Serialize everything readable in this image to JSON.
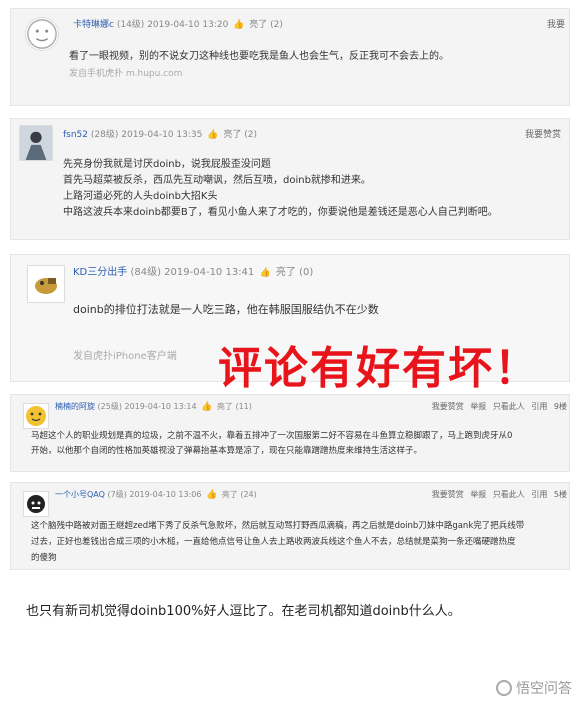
{
  "comments": [
    {
      "user": "卡特琳娜c",
      "level": "(14级)",
      "time": "2019-04-10 13:20",
      "like_label": "亮了",
      "like_count": "(2)",
      "right_action": "我要",
      "lines": [
        "看了一眼视频，别的不说女刀这种线也要吃我是鱼人也会生气，反正我可不会去上的。"
      ],
      "source": "发自手机虎扑 m.hupu.com"
    },
    {
      "user": "fsn52",
      "level": "(28级)",
      "time": "2019-04-10 13:35",
      "like_label": "亮了",
      "like_count": "(2)",
      "right_action": "我要赞赏",
      "lines": [
        "先亮身份我就是讨厌doinb，说我屁股歪没问题",
        "首先马超菜被反杀，西瓜先互动嘲讽，然后互喷，doinb就掺和进来。",
        "上路河道必死的人头doinb大招K头",
        "中路这波兵本来doinb都要B了，看见小鱼人来了才吃的，你要说他是差钱还是恶心人自己判断吧。"
      ]
    },
    {
      "user": "KD三分出手",
      "level": "(84级)",
      "time": "2019-04-10 13:41",
      "like_label": "亮了",
      "like_count": "(0)",
      "lines": [
        "doinb的排位打法就是一人吃三路，他在韩服国服结仇不在少数"
      ],
      "source": "发自虎扑iPhone客户端"
    },
    {
      "user": "楠楠的阿旋",
      "level": "(25级)",
      "time": "2019-04-10 13:14",
      "like_label": "亮了",
      "like_count": "(11)",
      "right_actions": [
        "我要赞赏",
        "举报",
        "只看此人",
        "引用",
        "9楼"
      ],
      "lines": [
        "马超这个人的职业规划是真的垃圾，之前不温不火，靠着五排冲了一次国服第二好不容易在斗鱼算立稳脚跟了，马上跑到虎牙从0",
        "开始，以他那个自闭的性格加英雄视没了弹幕抬基本算是凉了，现在只能靠蹭蹭热度来维持生活这样子。"
      ]
    },
    {
      "user": "一个小号QAQ",
      "level": "(7级)",
      "time": "2019-04-10 13:06",
      "like_label": "亮了",
      "like_count": "(24)",
      "right_actions": [
        "我要赞赏",
        "举报",
        "只看此人",
        "引用",
        "5楼"
      ],
      "lines": [
        "这个脑残中路被对面王继超zed堵下秀了反杀气急败坏，然后就互动骂打野西瓜滴稿，再之后就是doinb刀妹中路gank完了把兵线带",
        "过去，正好也差钱出合成三项的小木槌，一直给他点信号让鱼人去上路收两波兵线这个鱼人不去，总结就是菜狗一条还嘴硬蹭热度",
        "的傻狗"
      ]
    }
  ],
  "overlay_text": "评论有好有坏！",
  "caption": "也只有新司机觉得doinb100%好人逗比了。在老司机都知道doinb什么人。",
  "watermark": "悟空问答"
}
